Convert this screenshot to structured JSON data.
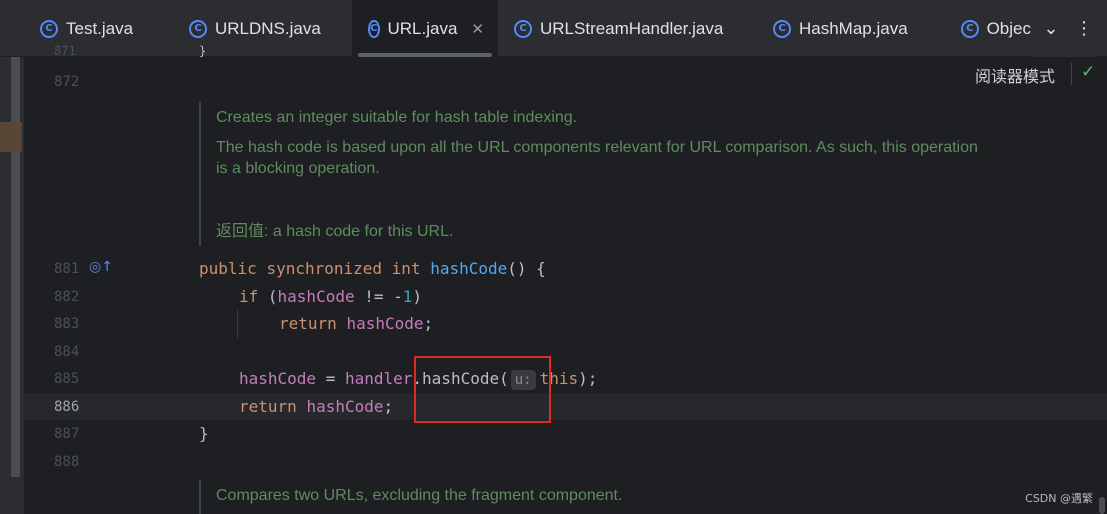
{
  "tabs": [
    {
      "label": "Test.java",
      "icon": "class-icon",
      "active": false
    },
    {
      "label": "URLDNS.java",
      "icon": "class-icon",
      "active": false
    },
    {
      "label": "URL.java",
      "icon": "class-icon",
      "active": true
    },
    {
      "label": "URLStreamHandler.java",
      "icon": "class-icon",
      "active": false
    },
    {
      "label": "HashMap.java",
      "icon": "class-icon",
      "active": false
    },
    {
      "label": "Objec",
      "icon": "class-icon",
      "active": false
    }
  ],
  "tab_icon_glyph": "C",
  "tab_close_glyph": "✕",
  "tabbar_controls": {
    "dropdown_glyph": "⌄",
    "more_glyph": "⋮"
  },
  "reader_mode": {
    "label": "阅读器模式",
    "check_glyph": "✓"
  },
  "line_numbers": {
    "l871": "871",
    "l872": "872",
    "l881": "881",
    "l882": "882",
    "l883": "883",
    "l884": "884",
    "l885": "885",
    "l886": "886",
    "l887": "887",
    "l888": "888"
  },
  "current_line": "886",
  "gutter_icon_glyph": "◎↑",
  "doc1": {
    "summary": "Creates an integer suitable for hash table indexing.",
    "detail": "The hash code is based upon all the URL components relevant for URL comparison. As such, this operation is a blocking operation.",
    "returns_label": "返回值:",
    "returns_text": " a hash code for this URL."
  },
  "code": {
    "prev_brace": "}",
    "l881": {
      "kw1": "public",
      "kw2": "synchronized",
      "kw3": "int",
      "fn": "hashCode",
      "rest": "() {"
    },
    "l882": {
      "kw": "if",
      "open": " (",
      "fld": "hashCode",
      "op": " != -",
      "num": "1",
      "close": ")"
    },
    "l883": {
      "kw": "return",
      "fld": "hashCode",
      "end": ";"
    },
    "l885": {
      "fld1": "hashCode",
      "op": " = ",
      "fld2": "handler",
      "call": ".hashCode(",
      "hint": "u:",
      "kw": "this",
      "end": ");"
    },
    "l886": {
      "kw": "return",
      "fld": "hashCode",
      "end": ";"
    },
    "l887": "}"
  },
  "doc2": {
    "summary": "Compares two URLs, excluding the fragment component."
  },
  "watermark": "CSDN @遇繁",
  "colors": {
    "keyword": "#cf8e6d",
    "function": "#56a8f5",
    "field": "#c77dbb",
    "number": "#2aacb8",
    "doc": "#5f8c5f",
    "highlight": "#e02826"
  }
}
